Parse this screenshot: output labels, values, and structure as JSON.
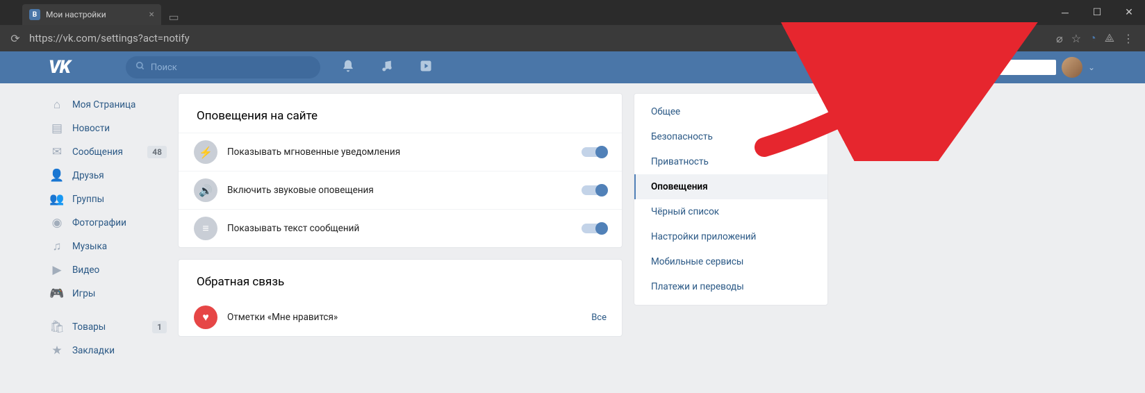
{
  "browser": {
    "tab_title": "Мои настройки",
    "url": "https://vk.com/settings?act=notify"
  },
  "header": {
    "search_placeholder": "Поиск"
  },
  "sidebar": {
    "items": [
      {
        "label": "Моя Страница",
        "icon": "home"
      },
      {
        "label": "Новости",
        "icon": "news"
      },
      {
        "label": "Сообщения",
        "icon": "messages",
        "badge": "48"
      },
      {
        "label": "Друзья",
        "icon": "friends"
      },
      {
        "label": "Группы",
        "icon": "groups"
      },
      {
        "label": "Фотографии",
        "icon": "photos"
      },
      {
        "label": "Музыка",
        "icon": "music"
      },
      {
        "label": "Видео",
        "icon": "video"
      },
      {
        "label": "Игры",
        "icon": "games"
      }
    ],
    "secondary": [
      {
        "label": "Товары",
        "icon": "market",
        "badge": "1"
      },
      {
        "label": "Закладки",
        "icon": "bookmark"
      }
    ]
  },
  "content": {
    "section1_title": "Оповещения на сайте",
    "rows": [
      {
        "label": "Показывать мгновенные уведомления"
      },
      {
        "label": "Включить звуковые оповещения"
      },
      {
        "label": "Показывать текст сообщений"
      }
    ],
    "section2_title": "Обратная связь",
    "feedback_row_label": "Отметки «Мне нравится»",
    "all_link": "Все"
  },
  "settings_nav": {
    "items": [
      "Общее",
      "Безопасность",
      "Приватность",
      "Оповещения",
      "Чёрный список",
      "Настройки приложений",
      "Мобильные сервисы",
      "Платежи и переводы"
    ],
    "active_index": 3
  }
}
